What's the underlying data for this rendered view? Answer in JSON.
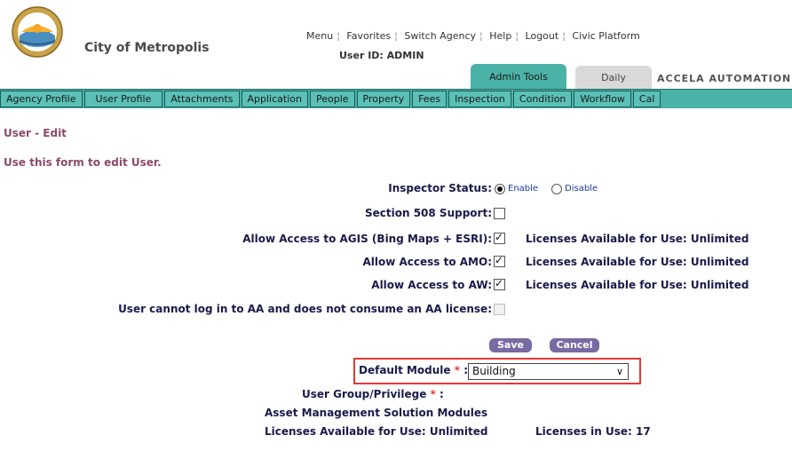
{
  "header": {
    "city_name": "City of Metropolis",
    "top_links": [
      "Menu",
      "Favorites",
      "Switch Agency",
      "Help",
      "Logout",
      "Civic Platform"
    ],
    "user_id": "User ID: ADMIN",
    "tabs": [
      {
        "label": "Admin Tools"
      },
      {
        "label": "Daily"
      }
    ],
    "brand": "ACCELA AUTOMATION©"
  },
  "navbar": {
    "items": [
      "Agency Profile",
      "User Profile",
      "Attachments",
      "Application",
      "People",
      "Property",
      "Fees",
      "Inspection",
      "Condition",
      "Workflow",
      "Cal"
    ]
  },
  "page": {
    "heading": "User - Edit",
    "instructions": "Use this form to edit User."
  },
  "form": {
    "inspector_status_label": "Inspector Status:",
    "inspector_status_options": [
      "Enable",
      "Disable"
    ],
    "inspector_status_selected": "Enable",
    "section508_label": "Section 508 Support:",
    "section508_checked": false,
    "agis_label": "Allow Access to AGIS (Bing Maps + ESRI):",
    "agis_checked": true,
    "agis_license": "Licenses Available for Use: Unlimited",
    "amo_label": "Allow Access to AMO:",
    "amo_checked": true,
    "amo_license": "Licenses Available for Use: Unlimited",
    "aw_label": "Allow Access to AW:",
    "aw_checked": true,
    "aw_license": "Licenses Available for Use: Unlimited",
    "no_aa_label": "User cannot log in to AA and does not consume an AA license:",
    "no_aa_checked": false,
    "save_label": "Save",
    "cancel_label": "Cancel",
    "default_module_label": "Default Module",
    "default_module_value": "Building",
    "required_marker": "*",
    "colon": ":",
    "user_group_label": "User Group/Privilege",
    "asset_management_label": "Asset Management Solution Modules",
    "licenses_available": "Licenses Available for Use: Unlimited",
    "licenses_in_use": "Licenses in Use: 17"
  }
}
